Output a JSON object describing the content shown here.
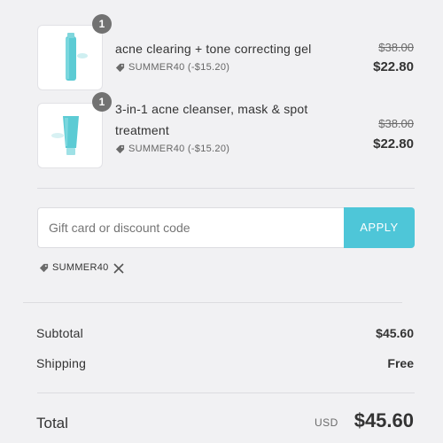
{
  "line_items": [
    {
      "quantity": "1",
      "title": "acne clearing + tone correcting gel",
      "discount": "SUMMER40 (-$15.20)",
      "original_price": "$38.00",
      "price": "$22.80"
    },
    {
      "quantity": "1",
      "title_line1": "3-in-1 acne cleanser, mask & spot",
      "title_line2": "treatment",
      "discount": "SUMMER40 (-$15.20)",
      "original_price": "$38.00",
      "price": "$22.80"
    }
  ],
  "discount_form": {
    "placeholder": "Gift card or discount code",
    "apply_label": "APPLY",
    "applied_code": "SUMMER40"
  },
  "summary": {
    "subtotal_label": "Subtotal",
    "subtotal_value": "$45.60",
    "shipping_label": "Shipping",
    "shipping_value": "Free",
    "total_label": "Total",
    "currency": "USD",
    "total_value": "$45.60"
  },
  "colors": {
    "accent": "#4ec6d8",
    "background": "#f1f1f3",
    "badge": "#727272"
  }
}
